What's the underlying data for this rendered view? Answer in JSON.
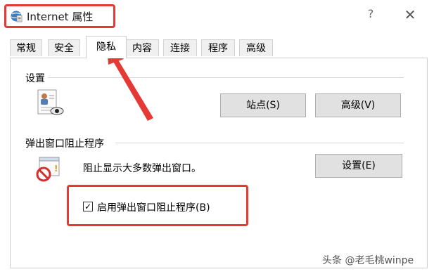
{
  "window": {
    "title": "Internet 属性",
    "help_glyph": "?",
    "close_glyph": "✕"
  },
  "tabs": [
    {
      "label": "常规"
    },
    {
      "label": "安全"
    },
    {
      "label": "隐私",
      "active": true
    },
    {
      "label": "内容"
    },
    {
      "label": "连接"
    },
    {
      "label": "程序"
    },
    {
      "label": "高级"
    }
  ],
  "settings_group": {
    "title": "设置",
    "sites_button": "站点(S)",
    "advanced_button": "高级(V)"
  },
  "popup_group": {
    "title": "弹出窗口阻止程序",
    "description": "阻止显示大多数弹出窗口。",
    "settings_button": "设置(E)",
    "checkbox_label": "启用弹出窗口阻止程序(B)",
    "checkbox_checked": true,
    "checkbox_mark": "✓"
  },
  "watermark": "头条 @老毛桃winpe",
  "colors": {
    "annotation_red": "#e53935",
    "button_bg": "#e1e1e1"
  }
}
